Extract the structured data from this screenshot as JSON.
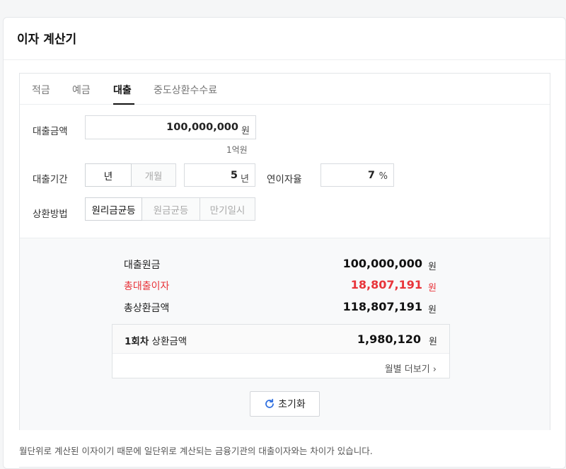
{
  "calculator": {
    "title": "이자 계산기",
    "tabs": [
      {
        "label": "적금",
        "active": false
      },
      {
        "label": "예금",
        "active": false
      },
      {
        "label": "대출",
        "active": true
      },
      {
        "label": "중도상환수수료",
        "active": false
      }
    ]
  },
  "form": {
    "amount_label": "대출금액",
    "amount_value": "100,000,000",
    "amount_unit": "원",
    "amount_korean": "1억원",
    "period_label": "대출기간",
    "period_unit_options": [
      "년",
      "개월"
    ],
    "period_unit_selected": "년",
    "period_value": "5",
    "period_unit": "년",
    "rate_label": "연이자율",
    "rate_value": "7",
    "rate_unit": "%",
    "method_label": "상환방법",
    "method_options": [
      "원리금균등",
      "원금균등",
      "만기일시"
    ],
    "method_selected": "원리금균등"
  },
  "result": {
    "principal_label": "대출원금",
    "principal_value": "100,000,000",
    "interest_label": "총대출이자",
    "interest_value": "18,807,191",
    "total_label": "총상환금액",
    "total_value": "118,807,191",
    "unit": "원",
    "installment_label_bold": "1회차",
    "installment_label_rest": " 상환금액",
    "installment_value": "1,980,120",
    "more_label": "월별 더보기",
    "reset_label": "초기화"
  },
  "footnote": "월단위로 계산된 이자이기 때문에 일단위로 계산되는 금융기관의 대출이자와는 차이가 있습니다.",
  "colors": {
    "accent_blue": "#2f6fe0",
    "highlight_red": "#e8343a"
  }
}
